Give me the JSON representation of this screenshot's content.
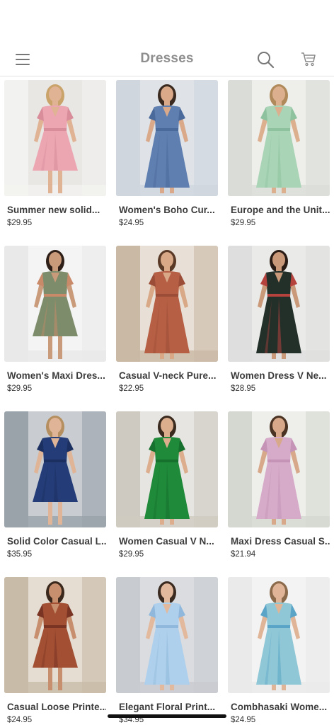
{
  "header": {
    "title": "Dresses",
    "menu_icon": "hamburger-menu-icon",
    "search_icon": "search-icon",
    "cart_icon": "shopping-cart-icon"
  },
  "products": [
    {
      "name": "Summer new solid...",
      "price": "$29.95",
      "colors": {
        "bg": "#e9e7e4",
        "accent": "#f2f2f0",
        "dress": "#eba6b2",
        "shade": "#d98d9b",
        "skin": "#e0b394"
      }
    },
    {
      "name": "Women's Boho Cur...",
      "price": "$24.95",
      "colors": {
        "bg": "#dfe3e8",
        "accent": "#cfd6dd",
        "dress": "#5f7fb0",
        "shade": "#4b6a9c",
        "skin": "#d9a98a"
      }
    },
    {
      "name": "Europe and the Unit...",
      "price": "$29.95",
      "colors": {
        "bg": "#eeeeea",
        "accent": "#d9dcd7",
        "dress": "#a9d4b6",
        "shade": "#8ec29f",
        "skin": "#dcb08f"
      }
    },
    {
      "name": "Women's Maxi Dres...",
      "price": "$29.95",
      "colors": {
        "bg": "#f4f4f4",
        "accent": "#e9e9e9",
        "dress": "#7d8c6a",
        "shade": "#c98a6a",
        "skin": "#c99b7b"
      }
    },
    {
      "name": "Casual V-neck Pure...",
      "price": "$22.95",
      "colors": {
        "bg": "#e8e0d6",
        "accent": "#c9b9a5",
        "dress": "#b65f45",
        "shade": "#9c4d37",
        "skin": "#d8a887"
      }
    },
    {
      "name": "Women Dress V Ne...",
      "price": "$28.95",
      "colors": {
        "bg": "#eaeae8",
        "accent": "#dedede",
        "dress": "#23302a",
        "shade": "#b6423e",
        "skin": "#c9997a"
      }
    },
    {
      "name": "Solid Color Casual L...",
      "price": "$35.95",
      "colors": {
        "bg": "#c9cdd2",
        "accent": "#9aa2aa",
        "dress": "#243d78",
        "shade": "#1b2f60",
        "skin": "#e0b597"
      }
    },
    {
      "name": "Women Casual V N...",
      "price": "$29.95",
      "colors": {
        "bg": "#e7e5e1",
        "accent": "#cfcac1",
        "dress": "#1f8a3a",
        "shade": "#16702e",
        "skin": "#dcae8e"
      }
    },
    {
      "name": "Maxi Dress Casual S...",
      "price": "$21.94",
      "colors": {
        "bg": "#eeeeeb",
        "accent": "#d5d8d0",
        "dress": "#d6aac9",
        "shade": "#c493b6",
        "skin": "#d7a98a"
      }
    },
    {
      "name": "Casual Loose Printe...",
      "price": "$24.95",
      "colors": {
        "bg": "#e5ddd2",
        "accent": "#c8bba8",
        "dress": "#a24f33",
        "shade": "#7a3424",
        "skin": "#c78f6d"
      }
    },
    {
      "name": "Elegant Floral Print...",
      "price": "$34.95",
      "colors": {
        "bg": "#dadce0",
        "accent": "#c8cbd0",
        "dress": "#aed0ec",
        "shade": "#8fb8dc",
        "skin": "#e2b99d"
      }
    },
    {
      "name": "Combhasaki Wome...",
      "price": "$24.95",
      "colors": {
        "bg": "#f3f3f3",
        "accent": "#eaeaea",
        "dress": "#8fc7d6",
        "shade": "#5aa5c7",
        "skin": "#e0b597"
      }
    }
  ]
}
